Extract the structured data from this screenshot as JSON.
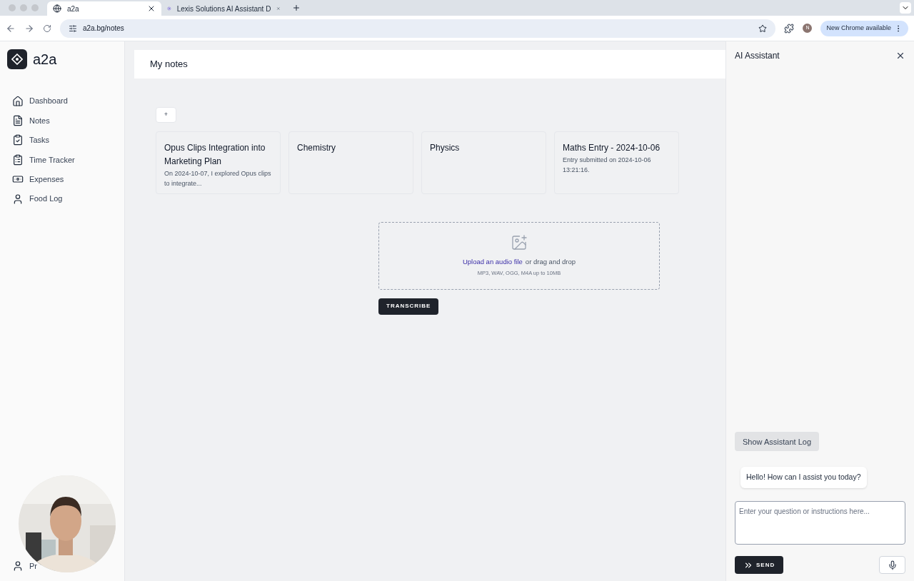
{
  "browser": {
    "tabs": [
      {
        "title": "a2a",
        "selected": true
      },
      {
        "title": "Lexis Solutions AI Assistant D",
        "selected": false
      }
    ],
    "url": "a2a.bg/notes",
    "profile_initial": "N",
    "update_label": "New Chrome available"
  },
  "sidebar": {
    "brand": "a2a",
    "items": [
      {
        "label": "Dashboard"
      },
      {
        "label": "Notes"
      },
      {
        "label": "Tasks"
      },
      {
        "label": "Time Tracker"
      },
      {
        "label": "Expenses"
      },
      {
        "label": "Food Log"
      }
    ],
    "footer": {
      "label": "Pr"
    }
  },
  "main": {
    "title": "My notes",
    "add_button": "+",
    "notes": [
      {
        "title": "Opus Clips Integration into Marketing Plan",
        "excerpt": "On 2024-10-07, I explored Opus clips to integrate..."
      },
      {
        "title": "Chemistry"
      },
      {
        "title": "Physics"
      },
      {
        "title": "Maths Entry - 2024-10-06",
        "excerpt": "Entry submitted on 2024-10-06 13:21:16."
      }
    ],
    "upload": {
      "link": "Upload an audio file",
      "text": "or drag and drop",
      "hint": "MP3, WAV, OGG, M4A up to 10MB"
    },
    "transcribe_button": "TRANSCRIBE"
  },
  "assistant": {
    "title": "AI Assistant",
    "log_button": "Show Assistant Log",
    "messages": [
      "Hello! How can I assist you today?"
    ],
    "input": {
      "placeholder": "Enter your question or instructions here..."
    },
    "send_button": "SEND"
  }
}
